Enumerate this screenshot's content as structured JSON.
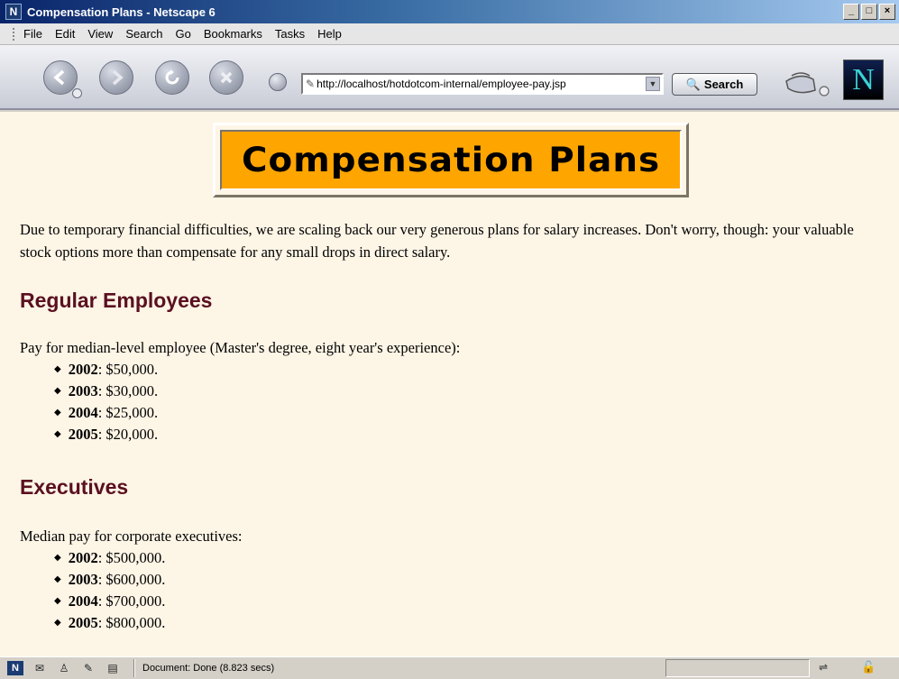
{
  "window": {
    "app_icon": "N",
    "title": "Compensation Plans - Netscape 6",
    "controls": {
      "minimize": "_",
      "maximize": "□",
      "close": "×"
    }
  },
  "menu": [
    "File",
    "Edit",
    "View",
    "Search",
    "Go",
    "Bookmarks",
    "Tasks",
    "Help"
  ],
  "toolbar": {
    "url": "http://localhost/hotdotcom-internal/employee-pay.jsp",
    "search_label": "Search",
    "icons": [
      "back-icon",
      "forward-icon",
      "reload-icon",
      "stop-icon",
      "home-icon",
      "search-icon",
      "print-icon",
      "netscape-logo"
    ],
    "logo_letter": "N"
  },
  "page": {
    "banner": "Compensation Plans",
    "intro": "Due to temporary financial difficulties, we are scaling back our very generous plans for salary increases. Don't worry, though: your valuable stock options more than compensate for any small drops in direct salary.",
    "sections": [
      {
        "heading": "Regular Employees",
        "lead": "Pay for median-level employee (Master's degree, eight year's experience):",
        "items": [
          {
            "year": "2002",
            "amount": ": $50,000."
          },
          {
            "year": "2003",
            "amount": ": $30,000."
          },
          {
            "year": "2004",
            "amount": ": $25,000."
          },
          {
            "year": "2005",
            "amount": ": $20,000."
          }
        ]
      },
      {
        "heading": "Executives",
        "lead": "Median pay for corporate executives:",
        "items": [
          {
            "year": "2002",
            "amount": ": $500,000."
          },
          {
            "year": "2003",
            "amount": ": $600,000."
          },
          {
            "year": "2004",
            "amount": ": $700,000."
          },
          {
            "year": "2005",
            "amount": ": $800,000."
          }
        ]
      }
    ]
  },
  "status": {
    "text": "Document: Done (8.823 secs)"
  },
  "colors": {
    "page_background": "#fdf5e6",
    "banner_background": "#ffa500",
    "heading": "#5a1020"
  }
}
